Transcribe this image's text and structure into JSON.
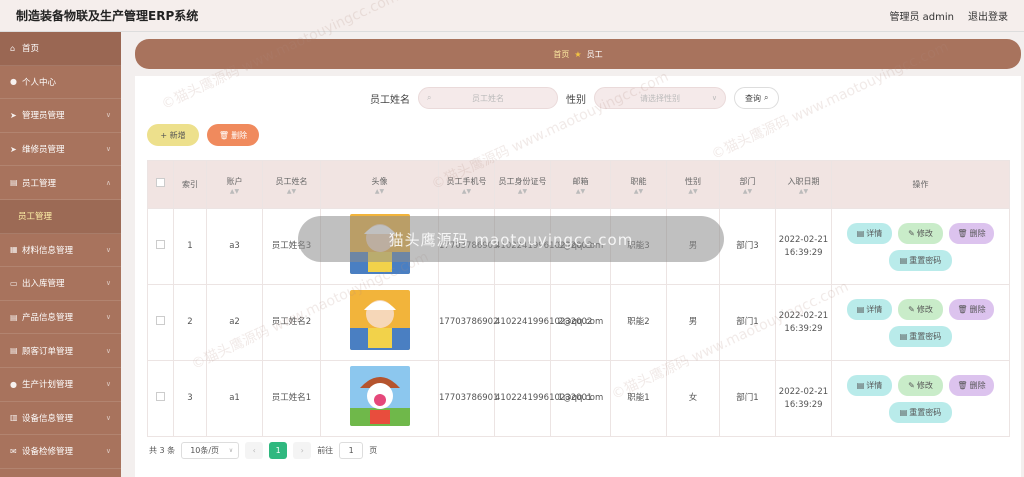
{
  "app": {
    "title": "制造装备物联及生产管理ERP系统"
  },
  "header": {
    "user_label": "管理员 admin",
    "logout_label": "退出登录"
  },
  "sidebar": {
    "items": [
      {
        "label": "首页",
        "icon": "home-icon"
      },
      {
        "label": "个人中心",
        "icon": "user-icon"
      },
      {
        "label": "管理员管理",
        "icon": "send-icon"
      },
      {
        "label": "维修员管理",
        "icon": "send-icon"
      },
      {
        "label": "员工管理",
        "icon": "doc-icon"
      },
      {
        "label": "员工管理",
        "icon": "",
        "sub": true
      },
      {
        "label": "材料信息管理",
        "icon": "grid-icon"
      },
      {
        "label": "出入库管理",
        "icon": "monitor-icon"
      },
      {
        "label": "产品信息管理",
        "icon": "doc-icon"
      },
      {
        "label": "顾客订单管理",
        "icon": "doc-icon"
      },
      {
        "label": "生产计划管理",
        "icon": "user-icon"
      },
      {
        "label": "设备信息管理",
        "icon": "chart-icon"
      },
      {
        "label": "设备检修管理",
        "icon": "mail-icon"
      }
    ]
  },
  "breadcrumb": {
    "home": "首页",
    "current": "员工"
  },
  "search": {
    "name_label": "员工姓名",
    "name_placeholder": "员工姓名",
    "gender_label": "性别",
    "gender_placeholder": "请选择性别",
    "query_label": "查询"
  },
  "actions": {
    "add_label": "+ 新增",
    "delete_label": "删除"
  },
  "table": {
    "headers": [
      "索引",
      "账户",
      "员工姓名",
      "头像",
      "员工手机号",
      "员工身份证号",
      "邮箱",
      "职能",
      "性别",
      "部门",
      "入职日期",
      "操作"
    ],
    "rows": [
      {
        "index": "1",
        "account": "a3",
        "name": "员工姓名3",
        "phone": "17703786903",
        "id_card": "410224199610232003",
        "email": "3@qq.com",
        "role": "职能3",
        "gender": "男",
        "dept": "部门3",
        "date": "2022-02-21 16:39:29"
      },
      {
        "index": "2",
        "account": "a2",
        "name": "员工姓名2",
        "phone": "17703786902",
        "id_card": "410224199610232002",
        "email": "2@qq.com",
        "role": "职能2",
        "gender": "男",
        "dept": "部门1",
        "date": "2022-02-21 16:39:29"
      },
      {
        "index": "3",
        "account": "a1",
        "name": "员工姓名1",
        "phone": "17703786901",
        "id_card": "410224199610232001",
        "email": "1@qq.com",
        "role": "职能1",
        "gender": "女",
        "dept": "部门1",
        "date": "2022-02-21 16:39:29"
      }
    ],
    "ops": {
      "detail": "详情",
      "edit": "修改",
      "remove": "删除",
      "reset": "重置密码"
    }
  },
  "pager": {
    "total": "共 3 条",
    "size": "10条/页",
    "page": "1",
    "goto": "前往",
    "goto_value": "1",
    "page_unit": "页"
  },
  "overlay": {
    "text": "猫头鹰源码  maotouyingcc.com"
  },
  "watermark": {
    "text": "©猫头鹰源码  www.maotouyingcc.com"
  },
  "colors": {
    "sidebar": "#a8735d",
    "accent_green": "#2fb87f",
    "delete": "#f08a5d",
    "add": "#ede08c"
  }
}
